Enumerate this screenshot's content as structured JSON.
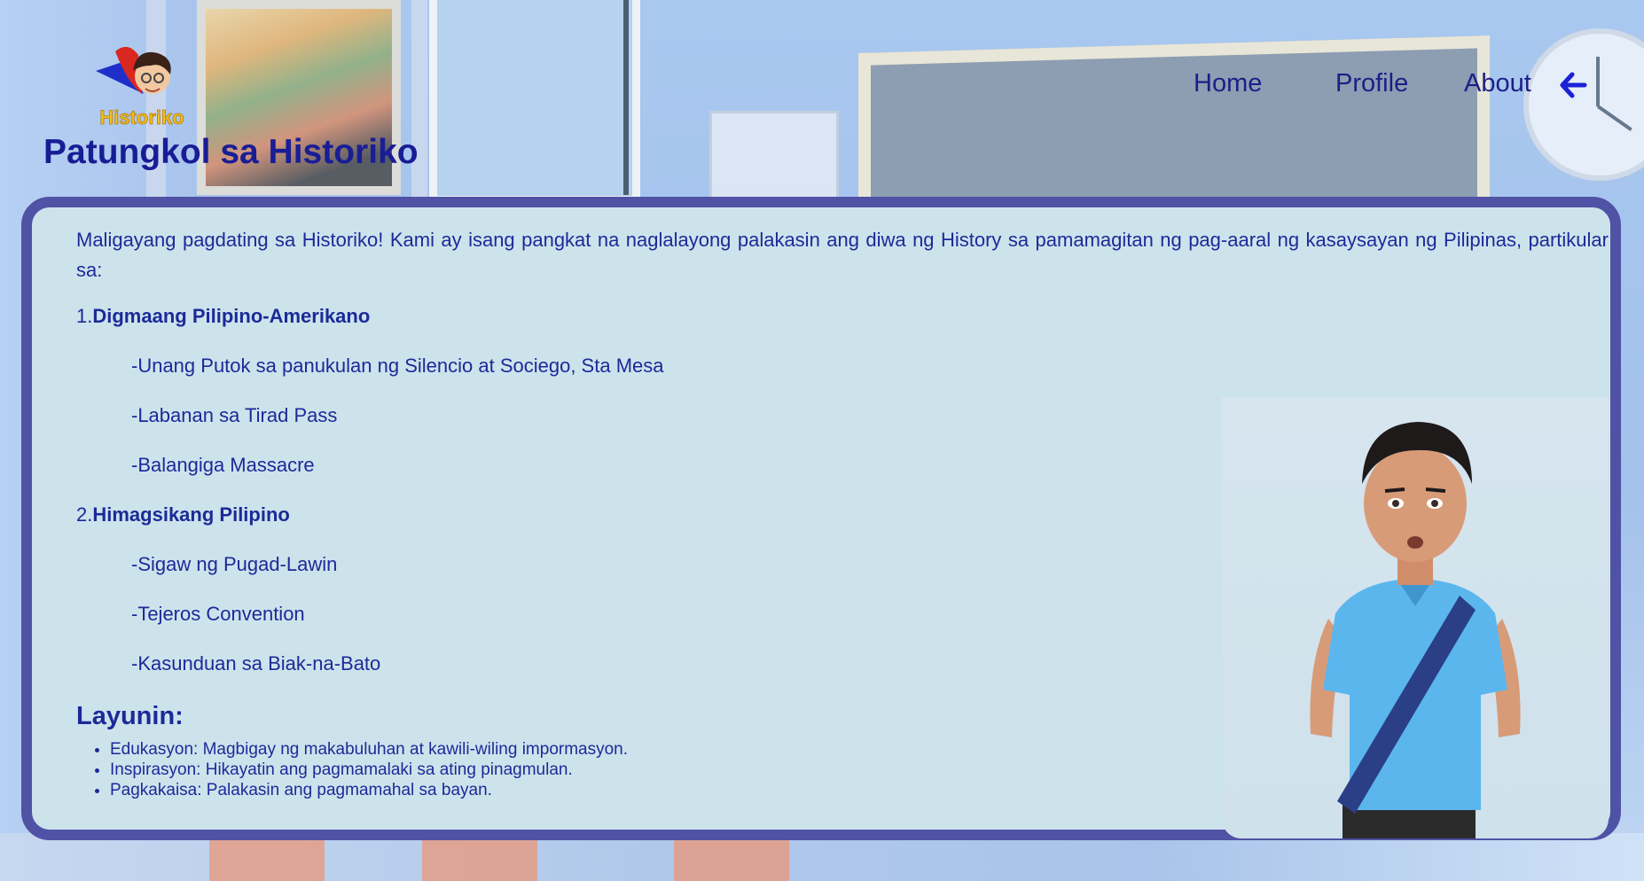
{
  "app": {
    "logo_text": "Historiko",
    "page_title": "Patungkol sa Historiko"
  },
  "nav": {
    "home": "Home",
    "profile": "Profile",
    "about": "About",
    "back_icon": "arrow-left-icon"
  },
  "colors": {
    "title": "#191d95",
    "card_border": "#5052a5",
    "card_bg": "#cde3ec",
    "text": "#1c2a98",
    "back_arrow": "#1a22d8"
  },
  "content": {
    "intro": "Maligayang pagdating sa Historiko! Kami ay isang pangkat na naglalayong palakasin ang diwa ng History sa pamamagitan ng pag-aaral ng kasaysayan ng Pilipinas, partikular sa:",
    "topics": [
      {
        "number": "1.",
        "title": "Digmaang Pilipino-Amerikano",
        "items": [
          "-Unang Putok sa panukulan ng Silencio at Sociego, Sta Mesa",
          "-Labanan sa Tirad Pass",
          "-Balangiga Massacre"
        ]
      },
      {
        "number": "2.",
        "title": "Himagsikang Pilipino",
        "items": [
          "-Sigaw ng Pugad-Lawin",
          "-Tejeros Convention",
          "-Kasunduan sa Biak-na-Bato"
        ]
      }
    ],
    "goals_title": "Layunin:",
    "goals": [
      "Edukasyon: Magbigay ng makabuluhan at kawili-wiling impormasyon.",
      "Inspirasyon: Hikayatin ang pagmamalaki sa ating pinagmulan.",
      "Pagkakaisa: Palakasin ang pagmamahal sa bayan."
    ]
  }
}
